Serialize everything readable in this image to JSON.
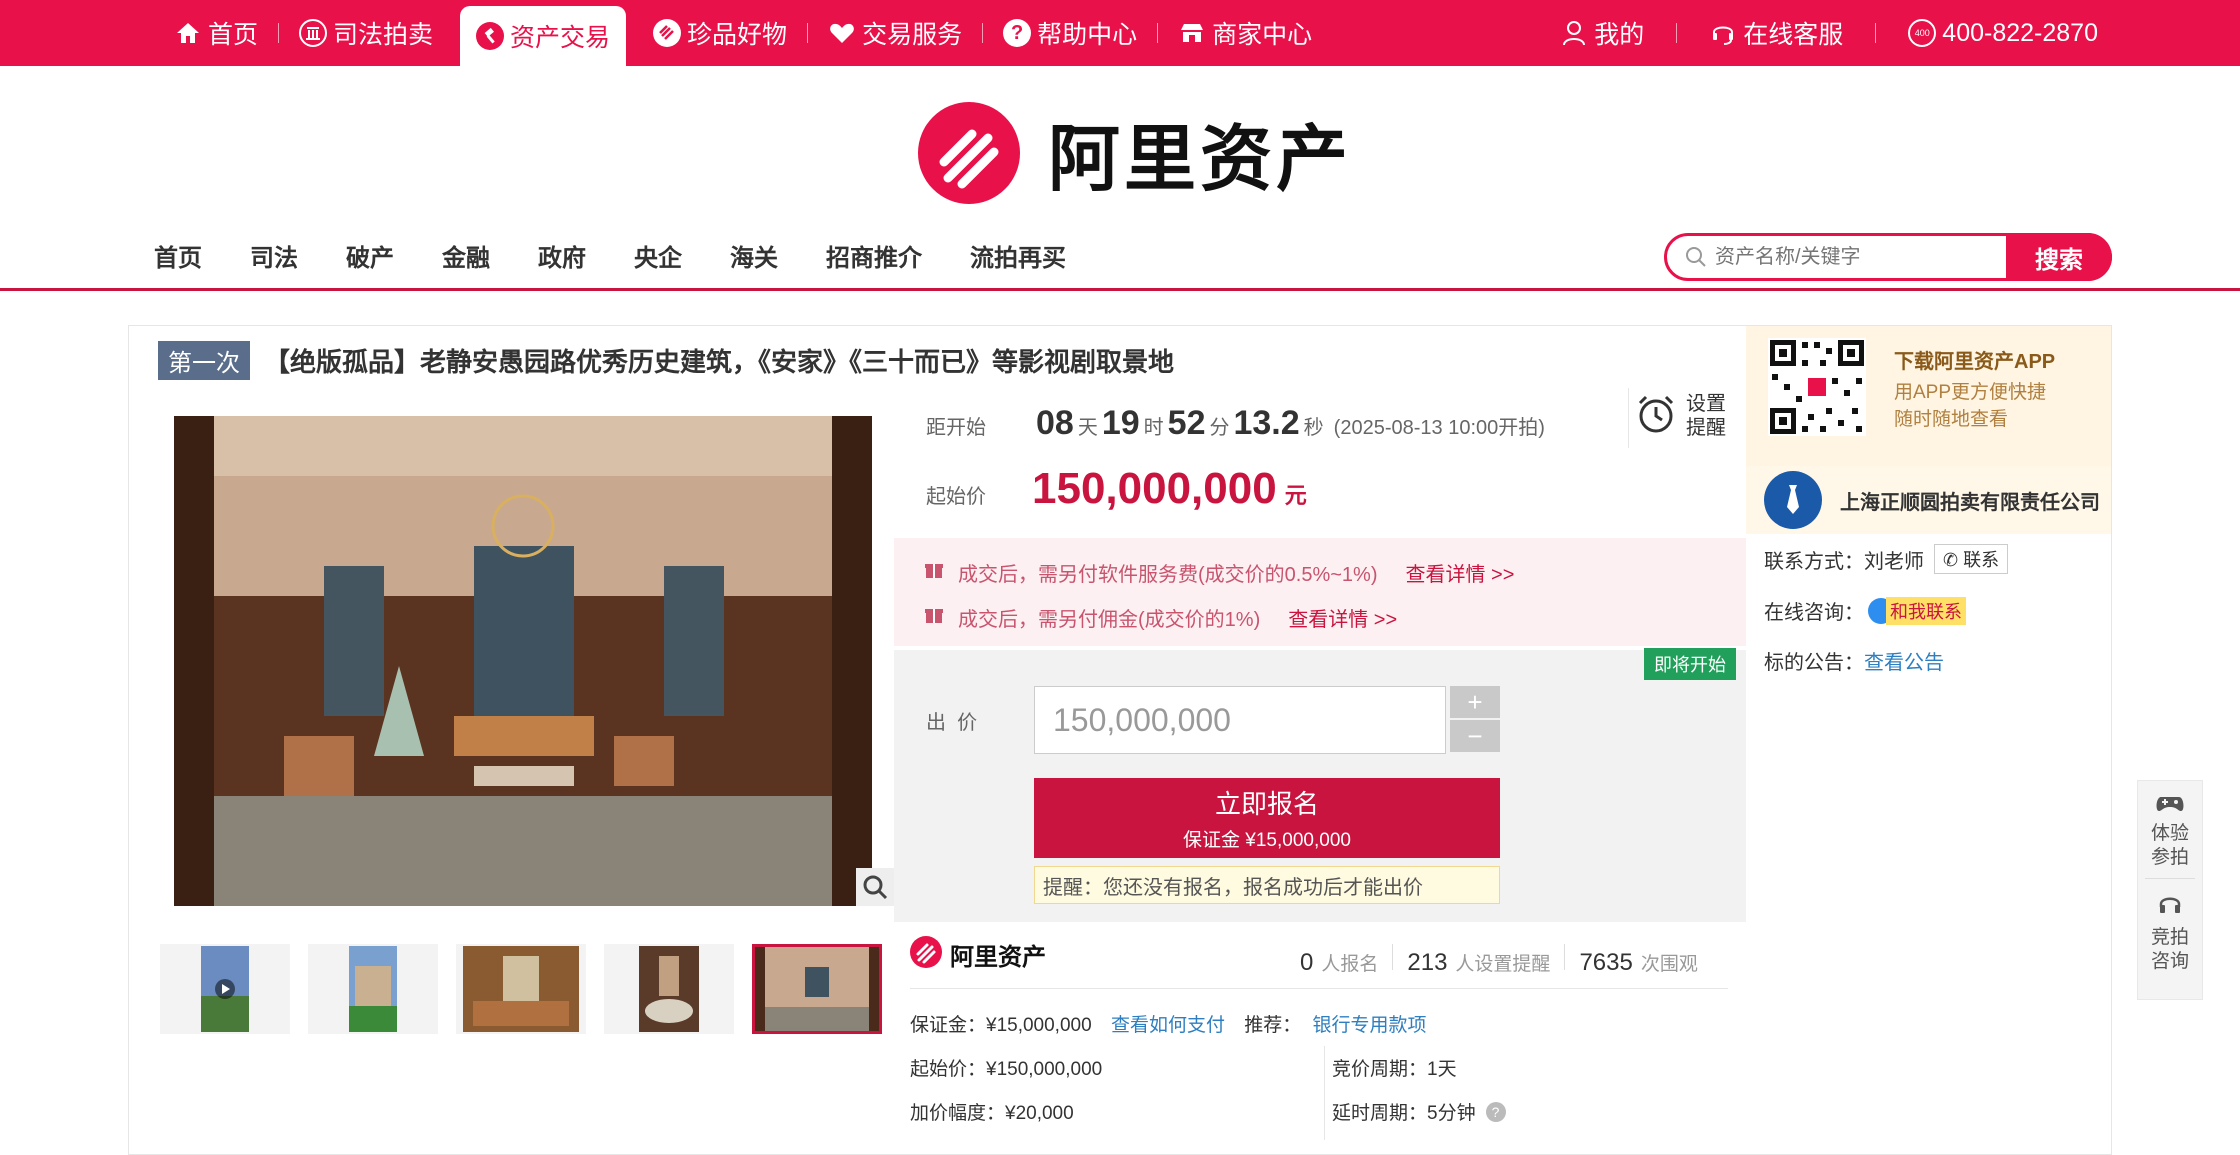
{
  "topnav": {
    "items": [
      {
        "label": "首页",
        "icon": "home-icon"
      },
      {
        "label": "司法拍卖",
        "icon": "court-icon"
      },
      {
        "label": "资产交易",
        "icon": "gavel-icon",
        "active": true
      },
      {
        "label": "珍品好物",
        "icon": "gem-icon"
      },
      {
        "label": "交易服务",
        "icon": "heart-icon"
      },
      {
        "label": "帮助中心",
        "icon": "question-icon"
      },
      {
        "label": "商家中心",
        "icon": "store-icon"
      }
    ],
    "right": {
      "mine": "我的",
      "service": "在线客服",
      "phone": "400-822-2870"
    }
  },
  "logo": {
    "text": "阿里资产"
  },
  "mainnav": {
    "items": [
      "首页",
      "司法",
      "破产",
      "金融",
      "政府",
      "央企",
      "海关",
      "招商推介",
      "流拍再买"
    ]
  },
  "search": {
    "placeholder": "资产名称/关键字",
    "button": "搜索"
  },
  "listing": {
    "badge": "第一次",
    "title": "【绝版孤品】老静安愚园路优秀历史建筑，《安家》《三十而已》等影视剧取景地"
  },
  "countdown": {
    "label": "距开始",
    "days": "08",
    "days_unit": "天",
    "hours": "19",
    "hours_unit": "时",
    "minutes": "52",
    "minutes_unit": "分",
    "seconds": "13.2",
    "seconds_unit": "秒",
    "start_time": "(2025-08-13 10:00开拍)"
  },
  "remind": {
    "line1": "设置",
    "line2": "提醒"
  },
  "start_price": {
    "label": "起始价",
    "value": "150,000,000",
    "unit": "元"
  },
  "notices": [
    {
      "text": "成交后，需另付软件服务费(成交价的0.5%~1%)",
      "link": "查看详情 >>"
    },
    {
      "text": "成交后，需另付佣金(成交价的1%)",
      "link": "查看详情 >>"
    }
  ],
  "bid": {
    "status_badge": "即将开始",
    "label": "出  价",
    "value": "150,000,000",
    "plus": "+",
    "minus": "−",
    "signup": "立即报名",
    "deposit": "保证金 ¥15,000,000",
    "tip": "提醒：您还没有报名，报名成功后才能出价"
  },
  "stats": {
    "brand": "阿里资产",
    "signups": "0",
    "signups_unit": "人报名",
    "reminders": "213",
    "reminders_unit": "人设置提醒",
    "views": "7635",
    "views_unit": "次围观"
  },
  "details": {
    "deposit_label": "保证金：¥15,000,000",
    "how_to_pay": "查看如何支付",
    "recommend_label": "推荐：",
    "recommend_link": "银行专用款项",
    "start_price": "起始价：¥150,000,000",
    "increment": "加价幅度：¥20,000",
    "period": "竞价周期：1天",
    "delay": "延时周期：5分钟"
  },
  "sidebar": {
    "app_title": "下载阿里资产APP",
    "app_desc1": "用APP更方便快捷",
    "app_desc2": "随时随地查看",
    "company": "上海正顺圆拍卖有限责任公司",
    "contact_label": "联系方式：",
    "contact_name": "刘老师",
    "contact_btn": "联系",
    "consult_label": "在线咨询：",
    "consult_btn": "和我联系",
    "notice_label": "标的公告：",
    "notice_link": "查看公告"
  },
  "float_panel": {
    "item1": "体验参拍",
    "item2": "竞拍咨询"
  },
  "colors": {
    "brand_red": "#e8114a",
    "accent_red": "#c8143e",
    "link_blue": "#2d7fc1",
    "status_green": "#20a05a"
  }
}
